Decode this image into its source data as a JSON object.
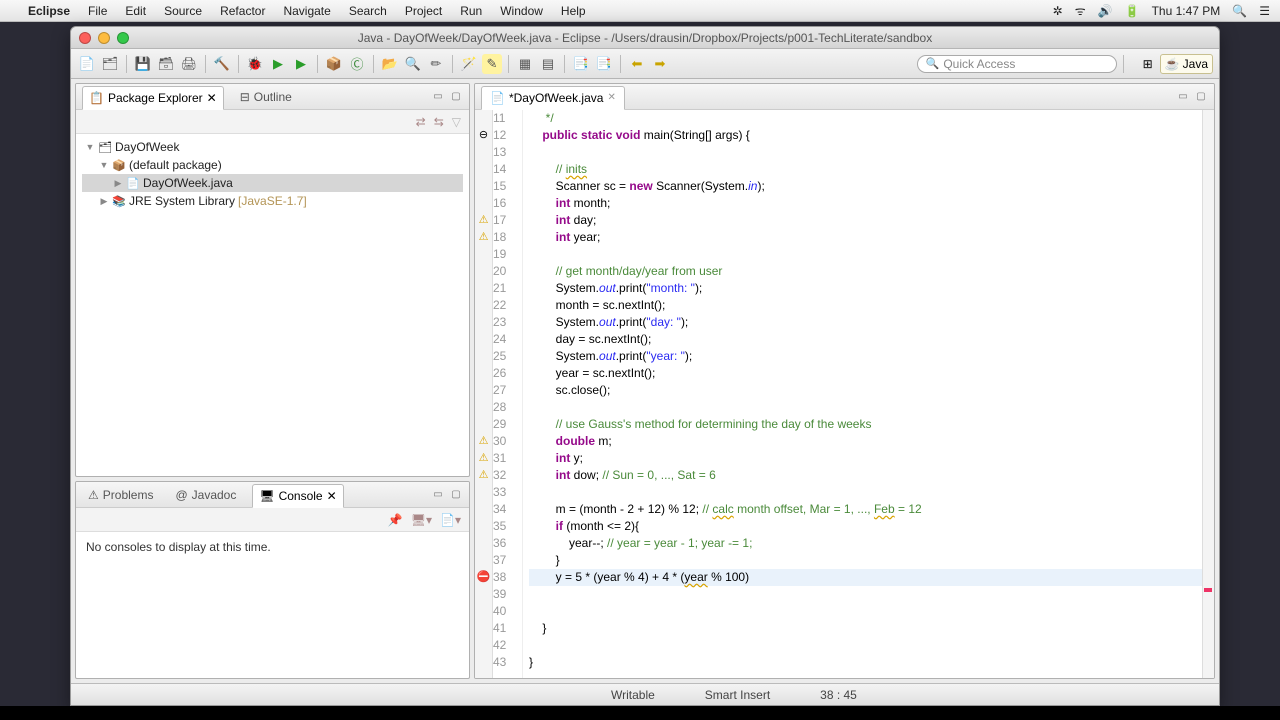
{
  "menubar": {
    "app": "Eclipse",
    "items": [
      "File",
      "Edit",
      "Source",
      "Refactor",
      "Navigate",
      "Search",
      "Project",
      "Run",
      "Window",
      "Help"
    ],
    "clock": "Thu 1:47 PM"
  },
  "title": "Java - DayOfWeek/DayOfWeek.java - Eclipse - /Users/drausin/Dropbox/Projects/p001-TechLiterate/sandbox",
  "quick_access": "Quick Access",
  "perspective": "Java",
  "pkgexp": {
    "tab": "Package Explorer",
    "other_tab": "Outline",
    "project": "DayOfWeek",
    "package": "(default package)",
    "file": "DayOfWeek.java",
    "lib": "JRE System Library",
    "libver": "[JavaSE-1.7]"
  },
  "problems_tab": "Problems",
  "javadoc_tab": "Javadoc",
  "console_tab": "Console",
  "console_msg": "No consoles to display at this time.",
  "editor_tab": "*DayOfWeek.java",
  "status": {
    "writable": "Writable",
    "insert": "Smart Insert",
    "loc": "38 : 45"
  }
}
